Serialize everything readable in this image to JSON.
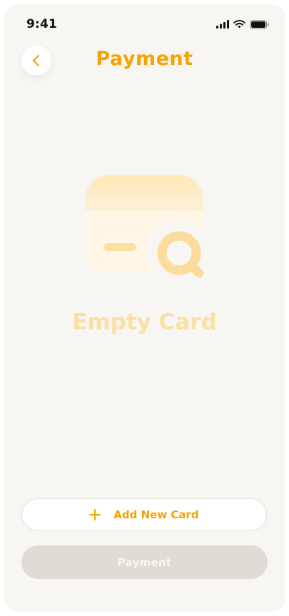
{
  "status_bar": {
    "time": "9:41",
    "icons": [
      "signal-icon",
      "wifi-icon",
      "battery-icon"
    ]
  },
  "header": {
    "back_icon": "chevron-left-icon",
    "title": "Payment"
  },
  "empty_state": {
    "illustration": "card-search-icon",
    "label": "Empty Card"
  },
  "actions": {
    "add_card_icon": "plus-icon",
    "add_card_label": "Add New Card",
    "payment_label": "Payment"
  },
  "colors": {
    "accent": "#f4a300",
    "background": "#f8f6f3",
    "disabled_button": "#dfdbd5",
    "empty_label": "#fbe0a6"
  }
}
